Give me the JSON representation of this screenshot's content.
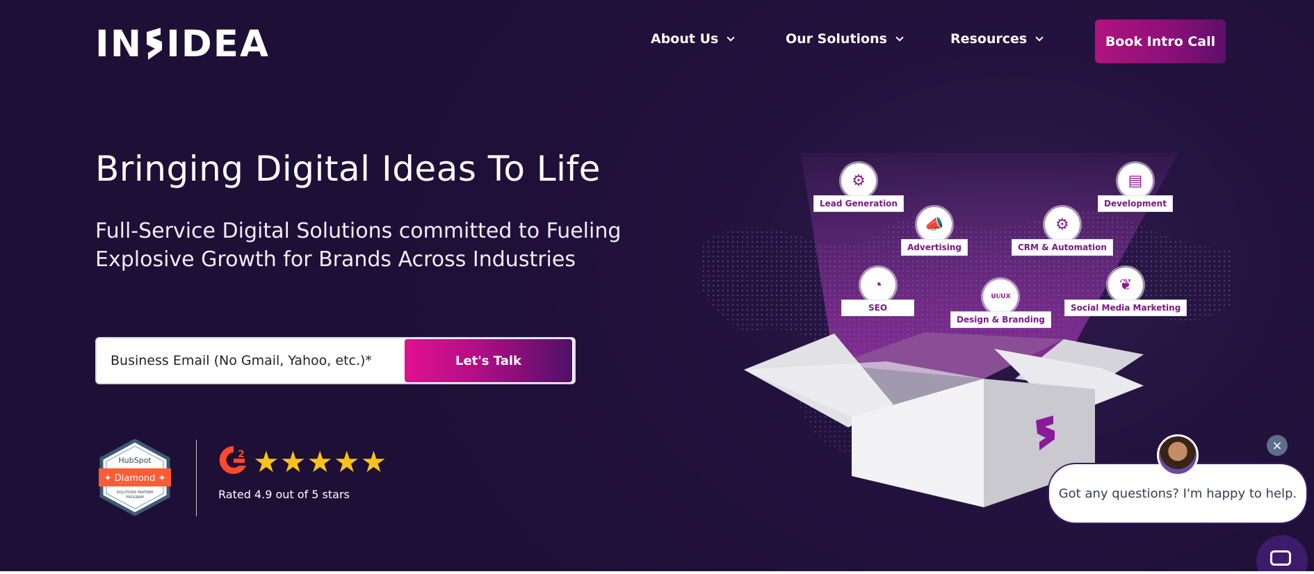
{
  "header": {
    "logo_text_left": "IN",
    "logo_text_right": "IDEA",
    "nav": [
      "About Us",
      "Our Solutions",
      "Resources"
    ],
    "cta_label": "Book Intro Call"
  },
  "hero": {
    "title": "Bringing Digital Ideas To Life",
    "subtitle": "Full-Service Digital Solutions committed to Fueling Explosive Growth for Brands Across Industries",
    "email_placeholder": "Business Email (No Gmail, Yahoo, etc.)*",
    "submit_label": "Let's Talk"
  },
  "badges": {
    "hubspot_brand": "HubSpot",
    "hubspot_tier": "Diamond",
    "hubspot_program": "SOLUTIONS PARTNER PROGRAM",
    "g2_rating_text": "Rated 4.9 out of 5 stars",
    "stars": 5
  },
  "services": [
    {
      "label": "Lead Generation",
      "icon": "monitor-gear-icon"
    },
    {
      "label": "Development",
      "icon": "browser-code-icon"
    },
    {
      "label": "Advertising",
      "icon": "megaphone-icon"
    },
    {
      "label": "CRM & Automation",
      "icon": "gears-icon"
    },
    {
      "label": "SEO",
      "icon": "seo-chart-icon"
    },
    {
      "label": "Design & Branding",
      "icon": "ui-ux-icon"
    },
    {
      "label": "Social Media Marketing",
      "icon": "social-hand-icon"
    }
  ],
  "box": {
    "ui_ux_tag": "UI/UX"
  },
  "chat": {
    "message": "Got any questions? I'm happy to help.",
    "close_glyph": "×"
  },
  "colors": {
    "background": "#1f1038",
    "accent_pink": "#e0118f",
    "accent_purple": "#4f1068",
    "star": "#f7c31a"
  }
}
